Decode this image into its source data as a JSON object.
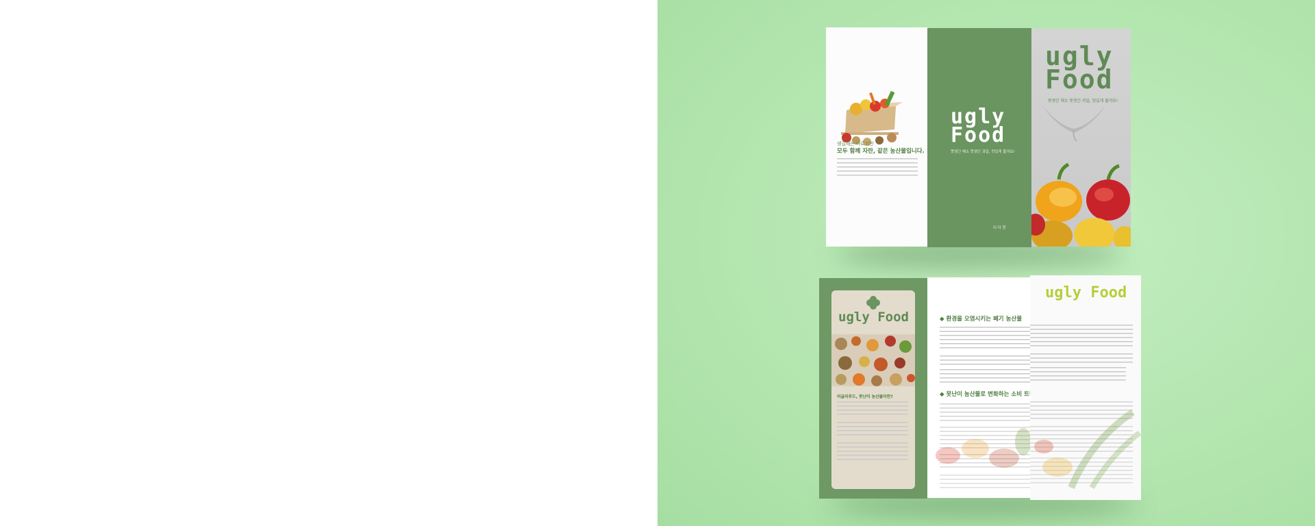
{
  "brochure_top": {
    "left_panel": {
      "subtitle": "생김새는 다르지만",
      "headline": "모두 함께 자란, 같은 농산물입니다."
    },
    "middle_panel": {
      "logo_line1": "ugly",
      "logo_line2": "Food",
      "tagline": "못생긴 채소 못생긴 과일, 맛있게 즐겨요!",
      "footer": "이 다 현"
    },
    "cover_panel": {
      "logo_line1": "ugly",
      "logo_line2": "Food",
      "tagline": "못생긴 채소 못생긴 과일, 맛있게 즐겨요!"
    }
  },
  "brochure_bottom": {
    "left_card": {
      "logo": "ugly Food",
      "heading": "어글리푸드, 못난이 농산물이란?"
    },
    "inside": {
      "logo": "ugly Food",
      "section1_title": "◆ 환경을 오염시키는 폐기 농산물",
      "section2_title": "◆ 못난이 농산물로 변화하는 소비 트렌드"
    }
  },
  "colors": {
    "page_left": "#ffffff",
    "page_right": "#b4e6b0",
    "brand_green": "#6a9460",
    "logo_dark_green": "#5f8a55",
    "logo_lime": "#b5cf3a",
    "heading_green": "#4e7d42"
  }
}
